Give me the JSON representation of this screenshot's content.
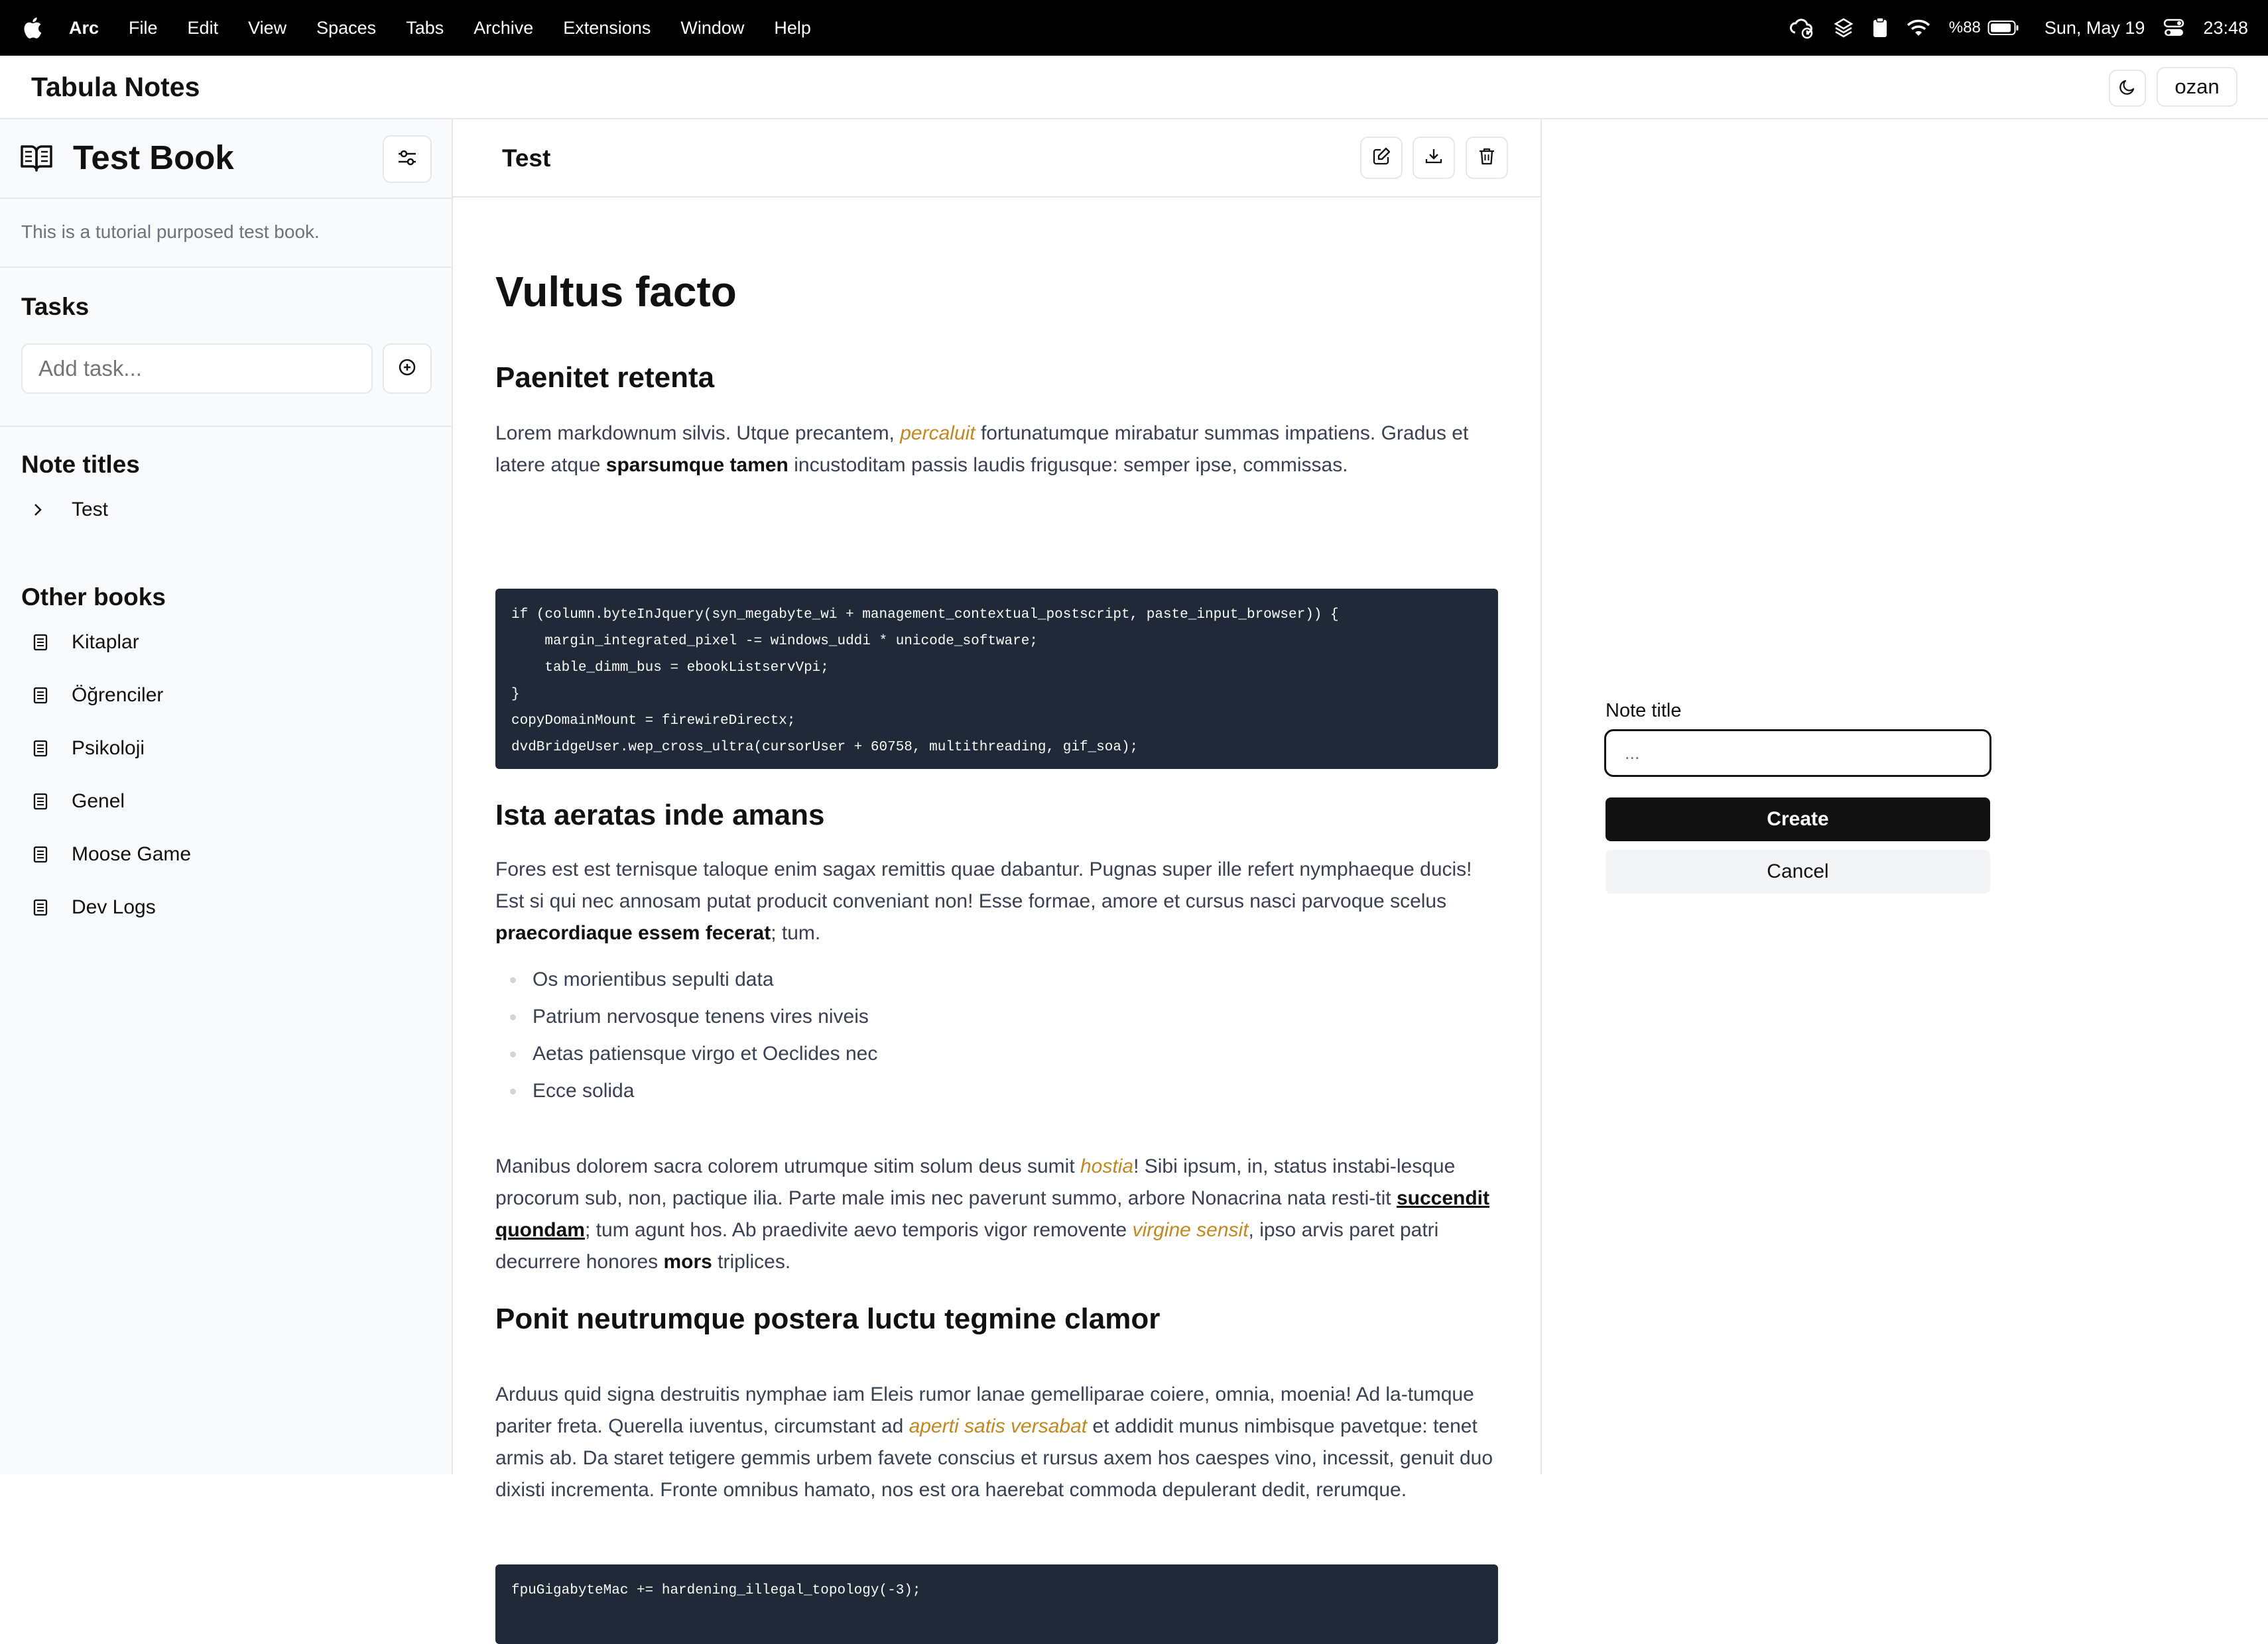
{
  "menubar": {
    "app": "Arc",
    "items": [
      "File",
      "Edit",
      "View",
      "Spaces",
      "Tabs",
      "Archive",
      "Extensions",
      "Window",
      "Help"
    ],
    "battery": "%88",
    "date": "Sun, May 19",
    "time": "23:48",
    "status_icons": [
      "cloud-sync-icon",
      "layers-icon",
      "clipboard-icon",
      "wifi-icon",
      "battery-icon",
      "control-center-icon"
    ]
  },
  "app": {
    "title": "Tabula Notes",
    "user": "ozan"
  },
  "sidebar": {
    "book_title": "Test Book",
    "book_description": "This is a tutorial purposed test book.",
    "tasks_heading": "Tasks",
    "task_placeholder": "Add task...",
    "notes_heading": "Note titles",
    "notes": [
      "Test"
    ],
    "books_heading": "Other books",
    "books": [
      "Kitaplar",
      "Öğrenciler",
      "Psikoloji",
      "Genel",
      "Moose Game",
      "Dev Logs"
    ]
  },
  "editor": {
    "note_title": "Test",
    "h1": "Vultus facto",
    "h2_1": "Paenitet retenta",
    "p1_a": "Lorem markdownum silvis. Utque precantem, ",
    "p1_i": "percaluit",
    "p1_b": " fortunatumque mirabatur summas impatiens. Gradus et latere atque ",
    "p1_bold": "sparsumque tamen",
    "p1_c": " incustoditam passis laudis frigusque: semper ipse, commissas.",
    "code1": "if (column.byteInJquery(syn_megabyte_wi + management_contextual_postscript, paste_input_browser)) {\n    margin_integrated_pixel -= windows_uddi * unicode_software;\n    table_dimm_bus = ebookListservVpi;\n}\ncopyDomainMount = firewireDirectx;\ndvdBridgeUser.wep_cross_ultra(cursorUser + 60758, multithreading, gif_soa);",
    "h2_2": "Ista aeratas inde amans",
    "p2_a": "Fores est est ternisque taloque enim sagax remittis quae dabantur. Pugnas super ille refert nymphaeque ducis! Est si qui nec annosam putat producit conveniant non! Esse formae, amore et cursus nasci parvoque scelus ",
    "p2_bold": "praecordiaque essem fecerat",
    "p2_c": "; tum.",
    "bullets": [
      "Os morientibus sepulti data",
      "Patrium nervosque tenens vires niveis",
      "Aetas patiensque virgo et Oeclides nec",
      "Ecce solida"
    ],
    "p3_a": "Manibus dolorem sacra colorem utrumque sitim solum deus sumit ",
    "p3_i1": "hostia",
    "p3_b": "! Sibi ipsum, in, status instabi-lesque procorum sub, non, pactique ilia. Parte male imis nec paverunt summo, arbore Nonacrina nata resti-tit ",
    "p3_link": "succendit quondam",
    "p3_c": "; tum agunt hos. Ab praedivite aevo temporis vigor removente ",
    "p3_i2": "virgine sensit",
    "p3_d": ", ipso arvis paret patri decurrere honores ",
    "p3_bold": "mors",
    "p3_e": " triplices.",
    "h2_3": "Ponit neutrumque postera luctu tegmine clamor",
    "p4_a": "Arduus quid signa destruitis nymphae iam Eleis rumor lanae gemelliparae coiere, omnia, moenia! Ad la-tumque pariter freta. Querella iuventus, circumstant ad ",
    "p4_i": "aperti satis versabat",
    "p4_b": " et addidit munus nimbisque pavetque: tenet armis ab. Da staret tetigere gemmis urbem favete conscius et rursus axem hos caespes vino, incessit, genuit duo dixisti incrementa. Fronte omnibus hamato, nos est ora haerebat commoda depulerant dedit, rerumque.",
    "code2": "fpuGigabyteMac += hardening_illegal_topology(-3);"
  },
  "form": {
    "label": "Note title",
    "input_value": "...",
    "create_label": "Create",
    "cancel_label": "Cancel"
  }
}
